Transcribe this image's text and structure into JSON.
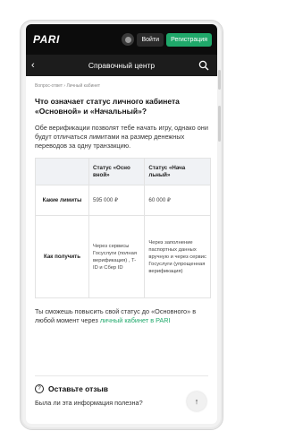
{
  "topbar": {
    "logo": "PARI",
    "login_label": "Войти",
    "register_label": "Регистрация"
  },
  "header": {
    "title": "Справочный центр",
    "back_icon": "chevron-left-icon",
    "search_icon": "search-icon"
  },
  "breadcrumb": "Вопрос-ответ  ›  Личный кабинет",
  "question_title": "Что означает статус личного кабинета «Основной» и «Начальный»?",
  "intro": "Обе верификации позволят тебе начать игру, однако они будут отличаться лимитами на размер денежных переводов за одну транзакцию.",
  "table": {
    "headers": [
      "",
      "Статус «Осно вной»",
      "Статус «Нача льный»"
    ],
    "rows": [
      {
        "label": "Какие лимиты",
        "basic": "595 000 ₽",
        "initial": "60 000 ₽"
      },
      {
        "label": "Как получить",
        "basic": "Через сервисы Госуслуги (полная верификация) , T-ID и Сбер ID",
        "initial": "Через заполнение паспортных данных вручную и через сервис Госуслуги (упрощенная верификация)"
      }
    ]
  },
  "footer_text": "Ты сможешь повысить свой статус до «Основного» в любой момент через ",
  "footer_link": "личный кабинет в PARI",
  "review": {
    "title": "Оставьте отзыв",
    "question": "Была ли эта информация полезна?"
  },
  "colors": {
    "accent": "#1fa86a",
    "topbar_bg": "#0c0c0c",
    "header_bg": "#1c1c1c"
  }
}
